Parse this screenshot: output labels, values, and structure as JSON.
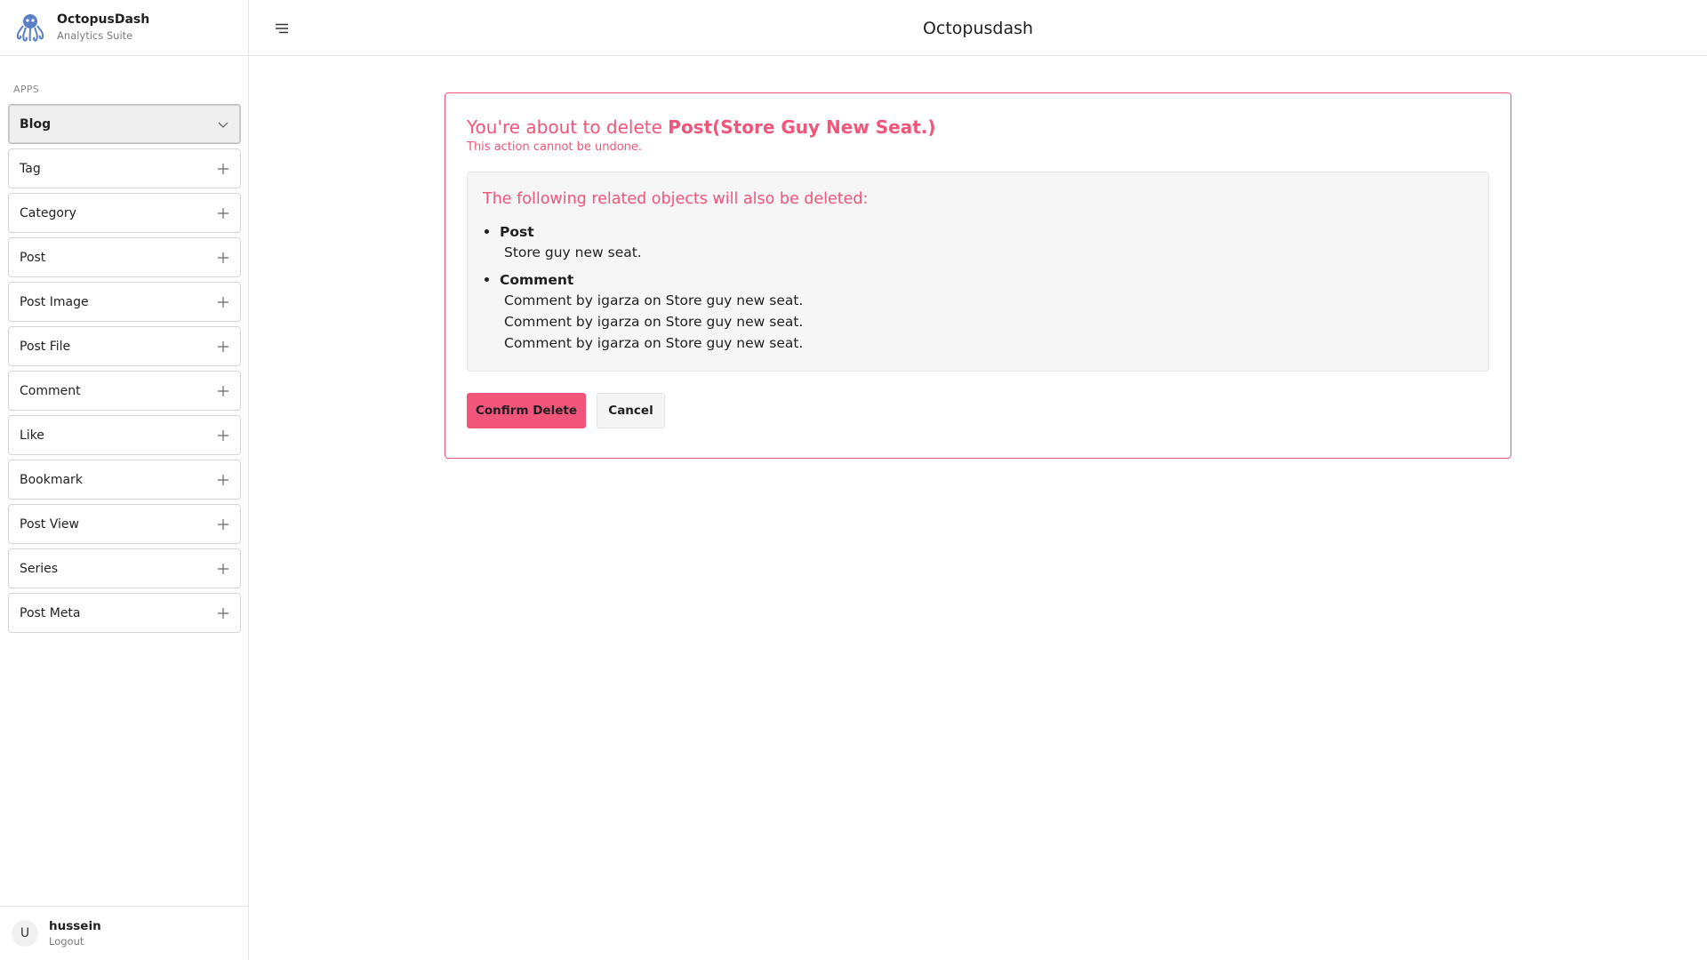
{
  "brand": {
    "name": "OctopusDash",
    "subtitle": "Analytics Suite"
  },
  "sidebar": {
    "section_label": "APPS",
    "items": [
      {
        "label": "Blog",
        "icon": "chevron-down-icon",
        "active": true
      },
      {
        "label": "Tag",
        "icon": "plus-icon"
      },
      {
        "label": "Category",
        "icon": "plus-icon"
      },
      {
        "label": "Post",
        "icon": "plus-icon"
      },
      {
        "label": "Post Image",
        "icon": "plus-icon"
      },
      {
        "label": "Post File",
        "icon": "plus-icon"
      },
      {
        "label": "Comment",
        "icon": "plus-icon"
      },
      {
        "label": "Like",
        "icon": "plus-icon"
      },
      {
        "label": "Bookmark",
        "icon": "plus-icon"
      },
      {
        "label": "Post View",
        "icon": "plus-icon"
      },
      {
        "label": "Series",
        "icon": "plus-icon"
      },
      {
        "label": "Post Meta",
        "icon": "plus-icon"
      }
    ]
  },
  "user": {
    "avatar_initial": "U",
    "name": "hussein",
    "logout_label": "Logout"
  },
  "header": {
    "title": "Octopusdash",
    "menu_icon": "menu-icon"
  },
  "delete_confirmation": {
    "title_prefix": "You're about to delete ",
    "title_object": "Post(Store Guy New Seat.)",
    "subtitle": "This action cannot be undone.",
    "related_heading": "The following related objects will also be deleted:",
    "related_groups": [
      {
        "name": "Post",
        "items": [
          "Store guy new seat."
        ]
      },
      {
        "name": "Comment",
        "items": [
          "Comment by igarza on Store guy new seat.",
          "Comment by igarza on Store guy new seat.",
          "Comment by igarza on Store guy new seat."
        ]
      }
    ],
    "confirm_label": "Confirm Delete",
    "cancel_label": "Cancel"
  },
  "colors": {
    "accent": "#f2557a",
    "active_bg": "#efefef",
    "border": "#e5e5e5"
  }
}
